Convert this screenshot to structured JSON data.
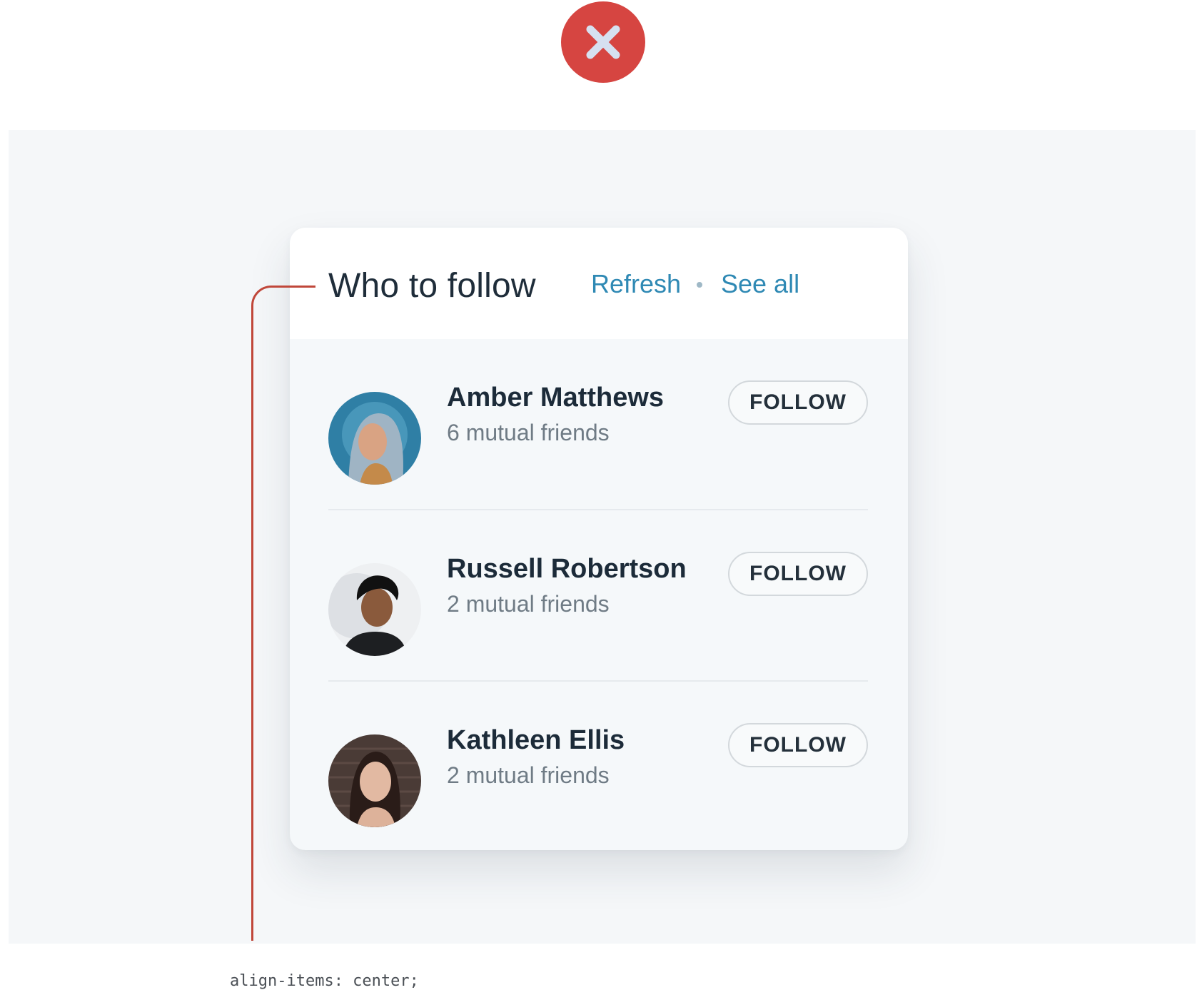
{
  "header": {
    "title": "Who to follow",
    "refresh_label": "Refresh",
    "see_all_label": "See all"
  },
  "suggestions": [
    {
      "name": "Amber Matthews",
      "mutual": "6 mutual friends",
      "follow_label": "FOLLOW"
    },
    {
      "name": "Russell Robertson",
      "mutual": "2 mutual friends",
      "follow_label": "FOLLOW"
    },
    {
      "name": "Kathleen Ellis",
      "mutual": "2 mutual friends",
      "follow_label": "FOLLOW"
    }
  ],
  "annotation": {
    "css_hint": "align-items: center;"
  },
  "icons": {
    "top_badge": "cross-icon",
    "guide": "guide-line"
  },
  "colors": {
    "accent": "#2f89b4",
    "error_badge": "#d64541",
    "guide_line": "#c0473a"
  }
}
